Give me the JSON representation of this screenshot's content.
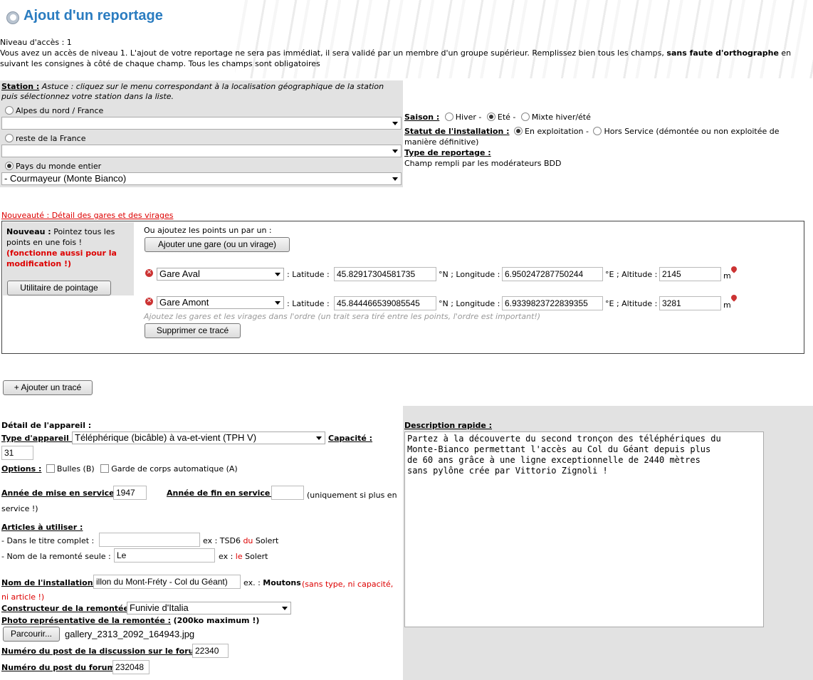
{
  "header": {
    "title": "Ajout d'un reportage"
  },
  "intro": {
    "access_level": "Niveau d'accès : 1",
    "text_a": "Vous avez un accès de niveau 1. L'ajout de votre reportage ne sera pas immédiat, il sera validé par un membre d'un groupe supérieur. Remplissez bien tous les champs, ",
    "text_bold": "sans faute d'orthographe",
    "text_b": " en suivant les consignes à côté de chaque champ. Tous les champs sont obligatoires"
  },
  "station": {
    "label": "Station :",
    "hint": " Astuce : cliquez sur le menu correspondant à la localisation géographique de la station puis sélectionnez votre station dans la liste.",
    "options": [
      "Alpes du nord / France",
      "reste de la France",
      "Pays du monde entier"
    ],
    "select1_value": "",
    "select2_value": "",
    "select3_value": "- Courmayeur (Monte Bianco)"
  },
  "season": {
    "label": "Saison :",
    "options": [
      "Hiver -",
      "Eté -",
      "Mixte hiver/été"
    ]
  },
  "status": {
    "label": "Statut de l'installation :",
    "opt1": "En exploitation -",
    "opt2": "Hors Service (démontée ou non exploitée de manière définitive)"
  },
  "report_type": {
    "label": "Type de reportage :",
    "value": "Champ rempli par les modérateurs BDD"
  },
  "stations_detail": {
    "title": "Nouveauté : Détail des gares et des virages",
    "nouveau_label": "Nouveau :",
    "nouveau_text": " Pointez tous les points en une fois !",
    "nouveau_red": "(fonctionne aussi pour la modification !)",
    "pointage_button": "Utilitaire de pointage",
    "one_by_one": "Ou ajoutez les points un par un :",
    "add_button": "Ajouter une gare (ou un virage)",
    "lat_label": ": Latitude :",
    "lat_unit": "°N ; Longitude :",
    "lon_unit": "°E ; Altitude :",
    "alt_unit": "m",
    "rows": [
      {
        "type": "Gare Aval",
        "lat": "45.82917304581735",
        "lon": "6.950247287750244",
        "alt": "2145"
      },
      {
        "type": "Gare Amont",
        "lat": "45.844466539085545",
        "lon": "6.9339823722839355",
        "alt": "3281"
      }
    ],
    "hint": "Ajoutez les gares et les virages dans l'ordre (un trait sera tiré entre les points, l'ordre est important!)",
    "delete_button": "Supprimer ce tracé",
    "add_trace_button": "+ Ajouter un tracé"
  },
  "device": {
    "section_label": "Détail de l'appareil :",
    "type_label": "Type d'appareil :",
    "type_value": "Téléphérique (bicâble) à va-et-vient (TPH V)",
    "capacity_label": "Capacité :",
    "capacity_value": "31",
    "options_label": "Options :",
    "opt_bulles": "Bulles (B)",
    "opt_garde": "Garde de corps automatique (A)",
    "year_start_label": "Année de mise en service :",
    "year_start_value": "1947",
    "year_end_label": "Année de fin en service :",
    "year_end_value": "",
    "year_end_note": "(uniquement si plus en service !)",
    "articles_label": "Articles à utiliser :",
    "title_full_label": "- Dans le titre complet :",
    "title_full_value": "",
    "title_full_ex_a": "ex : TSD6 ",
    "title_full_ex_red": "du",
    "title_full_ex_b": " Solert",
    "name_only_label": "- Nom de la remonté seule :",
    "name_only_value": "Le",
    "name_only_ex_a": "ex : ",
    "name_only_ex_red": "le",
    "name_only_ex_b": " Solert",
    "install_name_label": "Nom de l'installation :",
    "install_name_value": "illon du Mont-Fréty - Col du Géant)",
    "install_name_ex_a": "ex. : ",
    "install_name_ex_bold": "Moutons",
    "install_name_ex_red": "(sans type, ni capacité, ni article !)",
    "constructor_label": "Constructeur de la remontée :",
    "constructor_value": "Funivie d'Italia",
    "photo_label": "Photo représentative de la remontée :",
    "photo_note": "(200ko maximum !)",
    "browse_button": "Parcourir...",
    "photo_file": "gallery_2313_2092_164943.jpg",
    "discussion_label": "Numéro du post de la discussion sur le forum :",
    "discussion_value": "22340",
    "forum_label": "Numéro du post du forum :",
    "forum_value": "232048"
  },
  "description": {
    "label": "Description rapide :",
    "line1": "Partez à la découverte du second tronçon des téléphériques du",
    "line2": "Monte-Bianco permettant l'accès au Col du Géant depuis plus",
    "line3": "de 60 ans grâce à une ligne exceptionnelle de 2440 mètres",
    "line4": "sans pylône crée par Vittorio Zignoli !"
  },
  "colors": {
    "title_blue": "#2a7cc0",
    "red": "#dd0000",
    "panel_gray": "#e2e2e2"
  }
}
